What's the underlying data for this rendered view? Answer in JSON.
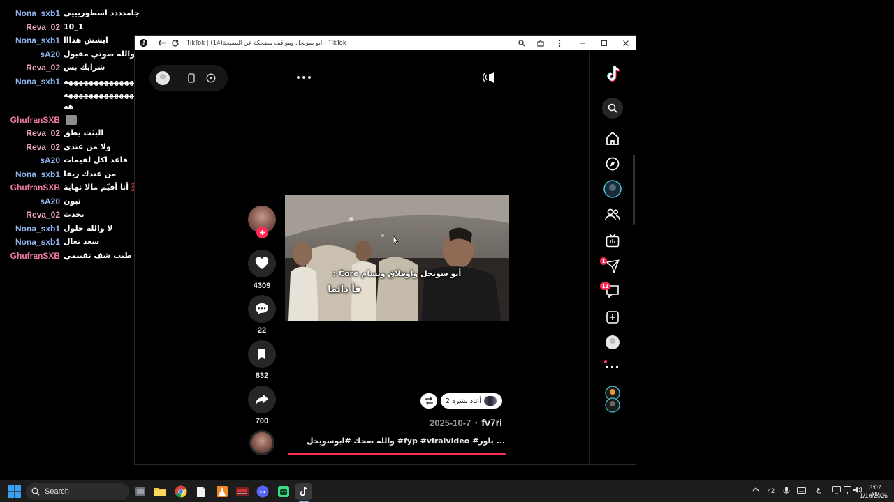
{
  "chat": [
    {
      "user": "Nona_sxb1",
      "msg": "جامدددد اسطوريييي",
      "color": "blue"
    },
    {
      "user": "Reva_02",
      "msg": "10_1",
      "color": "pink"
    },
    {
      "user": "Nona_sxb1",
      "msg": "ايشش هذااا",
      "color": "blue"
    },
    {
      "user": "sA20",
      "msg": "والله صوتي مقبول",
      "color": "blue"
    },
    {
      "user": "Reva_02",
      "msg": "شرايك بس",
      "color": "pink"
    },
    {
      "user": "Nona_sxb1",
      "msg": "ههههههههههههههههههههههههه",
      "color": "blue"
    },
    {
      "user": "",
      "msg": "ههههههههههههههههههههههههه",
      "color": "blue"
    },
    {
      "user": "",
      "msg": "هه",
      "color": "blue"
    },
    {
      "user": "GhufranSXB",
      "msg": "",
      "color": "red",
      "thumb": true
    },
    {
      "user": "Reva_02",
      "msg": "البثث يطق",
      "color": "pink"
    },
    {
      "user": "Reva_02",
      "msg": "ولا من عندي",
      "color": "pink"
    },
    {
      "user": "sA20",
      "msg": "قاعد اكل لقيمات",
      "color": "blue"
    },
    {
      "user": "Nona_sxb1",
      "msg": "من عندك ريفا",
      "color": "blue"
    },
    {
      "user": "GhufranSXB",
      "msg": "أنا أقيّم مالا نهاية 💯💯",
      "color": "red"
    },
    {
      "user": "sA20",
      "msg": "تبون",
      "color": "blue"
    },
    {
      "user": "Reva_02",
      "msg": "بحدث",
      "color": "pink"
    },
    {
      "user": "Nona_sxb1",
      "msg": "لا والله حلول",
      "color": "blue"
    },
    {
      "user": "Nona_sxb1",
      "msg": "سعد تعال",
      "color": "blue"
    },
    {
      "user": "GhufranSXB",
      "msg": "طيب شف تقييمي",
      "color": "red",
      "thumb": true
    }
  ],
  "window": {
    "title": "TikTok | أبو سويحل ومواقف مضحكة عن النصيحة(14) - TikTok"
  },
  "video": {
    "caption_line1": "أبو سويحل واوفلاق وبسام Core :",
    "caption_line2": "فأ دائما"
  },
  "actions": {
    "likes": "4309",
    "comments": "22",
    "saves": "832",
    "shares": "700"
  },
  "repost": {
    "label": "2 أعاد نشره"
  },
  "post": {
    "author": "fv7ri",
    "date": "2025-10-7",
    "separator": "·",
    "description": "والله ضحك #ابوسويحل #fyp #viralvideo #باور ..."
  },
  "sidebar": {
    "inbox_badge": "1",
    "messages_badge": "13",
    "more": "···"
  },
  "taskbar": {
    "search_placeholder": "Search",
    "temperature": "42",
    "lang": "ع",
    "time": "3:07 AM",
    "date": "1/16/2026"
  },
  "colors": {
    "accent": "#fe2c55",
    "user_blue": "#8fb4f0",
    "user_pink": "#f1a8be",
    "user_red": "#f07ca0"
  }
}
